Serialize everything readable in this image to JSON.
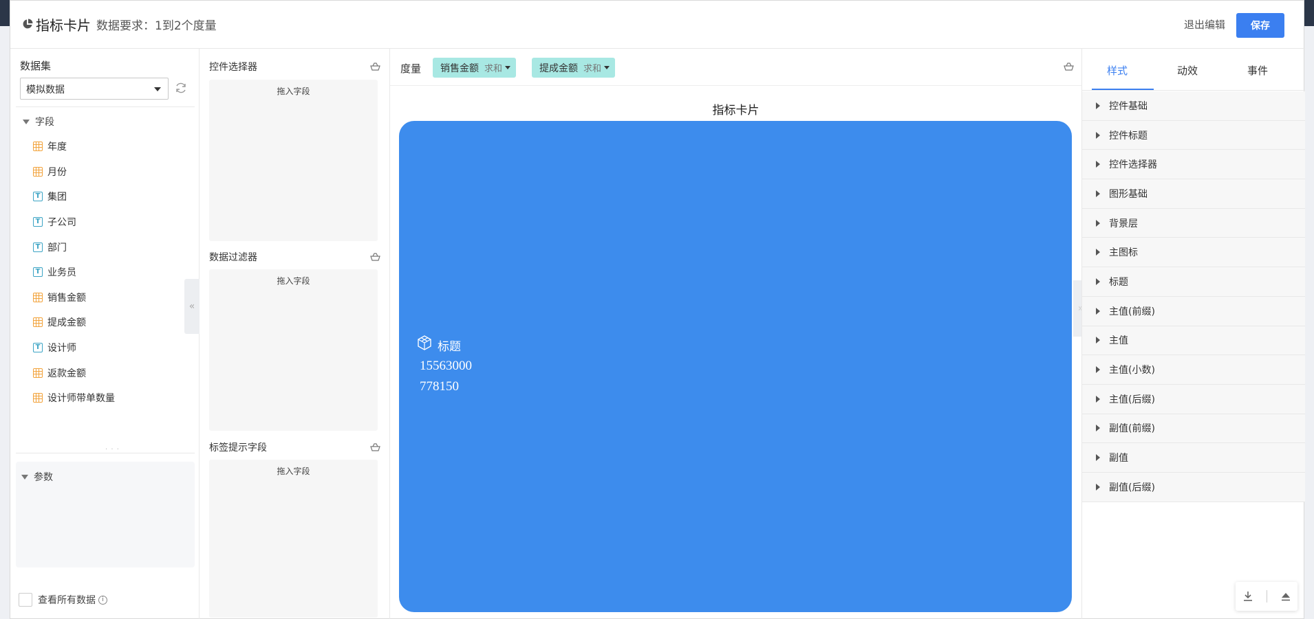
{
  "header": {
    "title": "指标卡片",
    "requirement": "数据要求：1到2个度量",
    "exit_label": "退出编辑",
    "save_label": "保存"
  },
  "dataset": {
    "label": "数据集",
    "selected": "模拟数据",
    "fields_group": "字段",
    "fields": [
      {
        "name": "年度",
        "type": "number"
      },
      {
        "name": "月份",
        "type": "number"
      },
      {
        "name": "集团",
        "type": "text"
      },
      {
        "name": "子公司",
        "type": "text"
      },
      {
        "name": "部门",
        "type": "text"
      },
      {
        "name": "业务员",
        "type": "text"
      },
      {
        "name": "销售金额",
        "type": "number"
      },
      {
        "name": "提成金额",
        "type": "number"
      },
      {
        "name": "设计师",
        "type": "text"
      },
      {
        "name": "返款金额",
        "type": "number"
      },
      {
        "name": "设计师带单数量",
        "type": "number"
      }
    ],
    "params_label": "参数",
    "view_all_label": "查看所有数据"
  },
  "controls": {
    "selector_title": "控件选择器",
    "filter_title": "数据过滤器",
    "tooltip_title": "标签提示字段",
    "drop_hint": "拖入字段"
  },
  "canvas": {
    "measure_label": "度量",
    "measures": [
      {
        "name": "销售金额",
        "agg": "求和"
      },
      {
        "name": "提成金额",
        "agg": "求和"
      }
    ],
    "card_title": "指标卡片",
    "card": {
      "label": "标题",
      "value1": "15563000",
      "value2": "778150",
      "color": "#3d8ced"
    }
  },
  "style_panel": {
    "tabs": [
      "样式",
      "动效",
      "事件"
    ],
    "active_tab": "样式",
    "sections": [
      "控件基础",
      "控件标题",
      "控件选择器",
      "图形基础",
      "背景层",
      "主图标",
      "标题",
      "主值(前缀)",
      "主值",
      "主值(小数)",
      "主值(后缀)",
      "副值(前缀)",
      "副值",
      "副值(后缀)"
    ]
  },
  "colors": {
    "accent": "#3b7ff0",
    "measure_pill": "#a8e8e3",
    "number_field": "#f2a23a",
    "text_field": "#3aa3c4"
  }
}
